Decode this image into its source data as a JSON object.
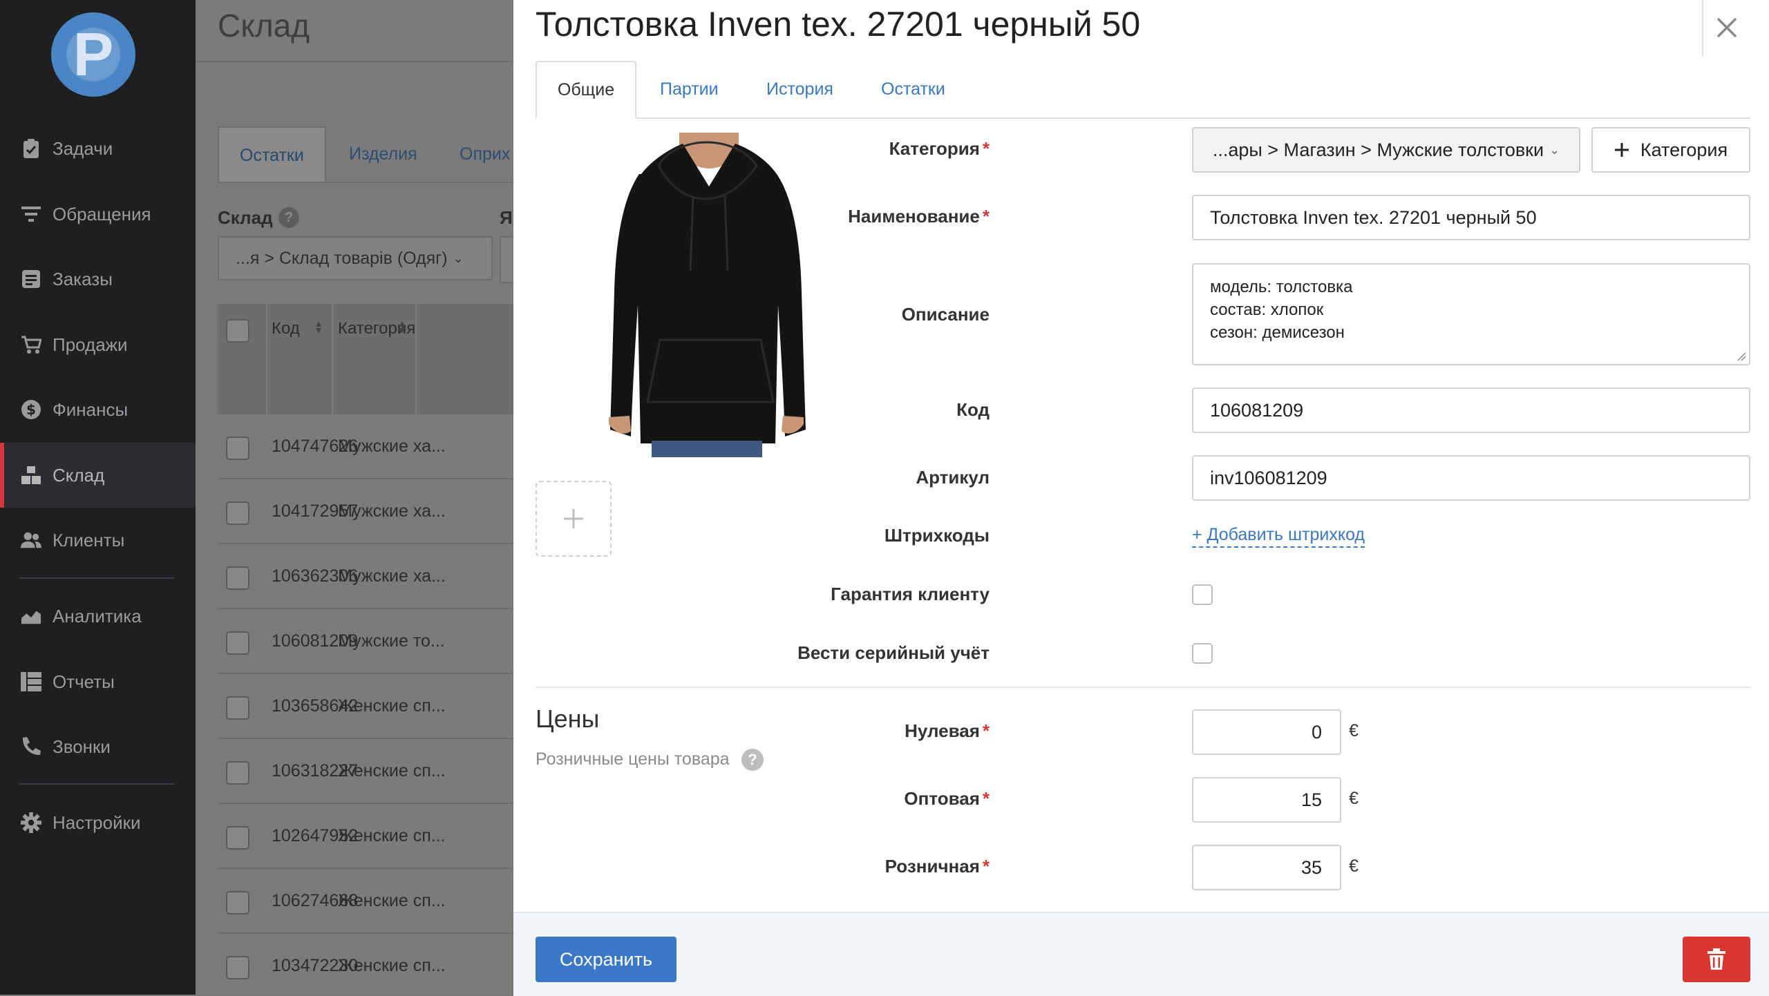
{
  "sidebar": {
    "items": [
      {
        "label": "Задачи",
        "icon": "clipboard-icon"
      },
      {
        "label": "Обращения",
        "icon": "filter-icon"
      },
      {
        "label": "Заказы",
        "icon": "order-icon"
      },
      {
        "label": "Продажи",
        "icon": "cart-icon"
      },
      {
        "label": "Финансы",
        "icon": "dollar-icon"
      },
      {
        "label": "Склад",
        "icon": "warehouse-icon"
      },
      {
        "label": "Клиенты",
        "icon": "users-icon"
      },
      {
        "label": "Аналитика",
        "icon": "chart-icon"
      },
      {
        "label": "Отчеты",
        "icon": "table-icon"
      },
      {
        "label": "Звонки",
        "icon": "phone-icon"
      },
      {
        "label": "Настройки",
        "icon": "gear-icon"
      }
    ],
    "active": "Склад"
  },
  "background": {
    "title": "Склад",
    "tabs": [
      "Остатки",
      "Изделия",
      "Оприх"
    ],
    "warehouse_label": "Склад",
    "second_label": "Я",
    "warehouse_select": "...я > Склад товарів (Одяг)",
    "columns": [
      "Код",
      "Категория"
    ],
    "rows": [
      {
        "code": "104747626",
        "category": "Мужские ха..."
      },
      {
        "code": "104172957",
        "category": "Мужские ха..."
      },
      {
        "code": "106362306",
        "category": "Мужские ха..."
      },
      {
        "code": "106081209",
        "category": "Мужские то..."
      },
      {
        "code": "103658642",
        "category": "Женские сп..."
      },
      {
        "code": "106318227",
        "category": "Женские сп..."
      },
      {
        "code": "102647952",
        "category": "Женские сп..."
      },
      {
        "code": "106274668",
        "category": "Женские сп..."
      },
      {
        "code": "103472230",
        "category": "Женские сп..."
      }
    ]
  },
  "modal": {
    "title": "Толстовка Inven tex. 27201 черный 50",
    "tabs": [
      "Общие",
      "Партии",
      "История",
      "Остатки"
    ],
    "active_tab": "Общие",
    "fields": {
      "category": {
        "label": "Категория",
        "value": "...ары > Магазин > Мужские толстовки",
        "add_button": "Категория"
      },
      "name": {
        "label": "Наименование",
        "value": "Толстовка Inven tex. 27201 черный 50"
      },
      "description": {
        "label": "Описание",
        "lines": [
          "модель: толстовка",
          "состав: хлопок",
          "сезон: демисезон"
        ]
      },
      "code": {
        "label": "Код",
        "value": "106081209"
      },
      "article": {
        "label": "Артикул",
        "value": "inv106081209"
      },
      "barcodes": {
        "label": "Штрихкоды",
        "link": "+ Добавить штрихкод"
      },
      "warranty": {
        "label": "Гарантия клиенту",
        "checked": false
      },
      "serial": {
        "label": "Вести серийный учёт",
        "checked": false
      }
    },
    "prices": {
      "title": "Цены",
      "subtitle": "Розничные цены товара",
      "currency": "€",
      "items": [
        {
          "label": "Нулевая",
          "value": "0"
        },
        {
          "label": "Оптовая",
          "value": "15"
        },
        {
          "label": "Розничная",
          "value": "35"
        }
      ]
    },
    "footer": {
      "save_label": "Сохранить"
    }
  },
  "colors": {
    "accent": "#3b78c6",
    "danger": "#d93630",
    "required": "#d23a3a",
    "sidebar_bg": "#1e1f21"
  }
}
